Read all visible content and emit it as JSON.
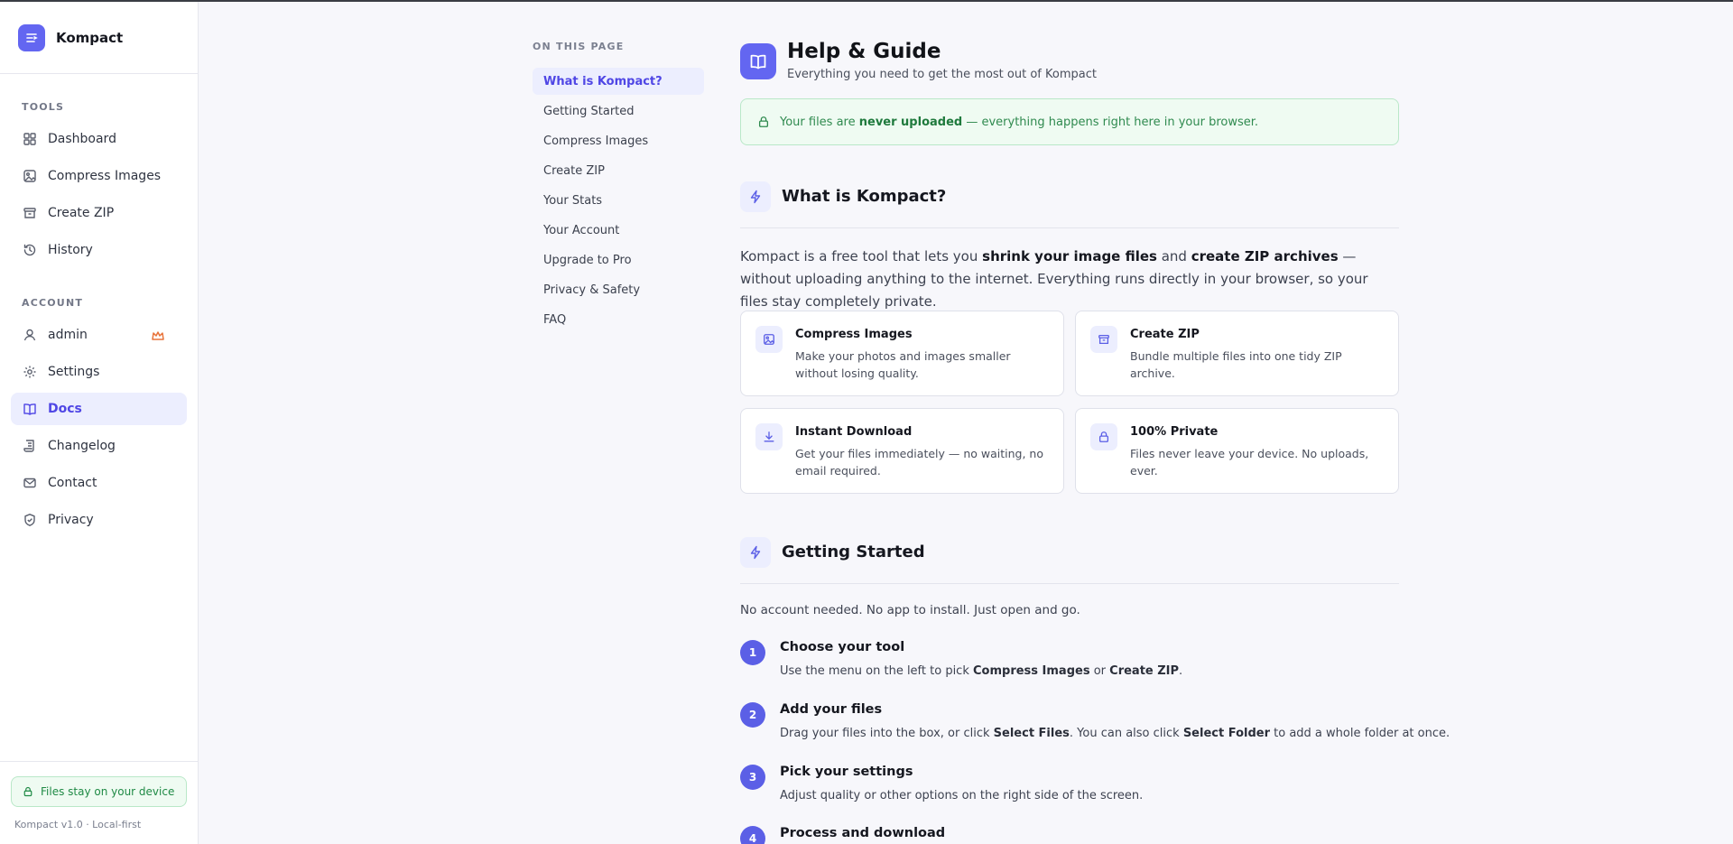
{
  "app": {
    "name": "Kompact",
    "version": "Kompact v1.0 · Local-first"
  },
  "sidebar": {
    "tools_heading": "TOOLS",
    "account_heading": "ACCOUNT",
    "tools": [
      {
        "label": "Dashboard",
        "icon": "grid-icon"
      },
      {
        "label": "Compress Images",
        "icon": "image-icon"
      },
      {
        "label": "Create ZIP",
        "icon": "archive-icon"
      },
      {
        "label": "History",
        "icon": "history-icon"
      }
    ],
    "account": [
      {
        "label": "admin",
        "icon": "user-icon",
        "badge": "crown-icon"
      },
      {
        "label": "Settings",
        "icon": "gear-icon"
      },
      {
        "label": "Docs",
        "icon": "book-icon",
        "active": true
      },
      {
        "label": "Changelog",
        "icon": "scroll-icon"
      },
      {
        "label": "Contact",
        "icon": "mail-icon"
      },
      {
        "label": "Privacy",
        "icon": "shield-icon"
      }
    ],
    "device_badge": "Files stay on your device"
  },
  "toc": {
    "title": "ON THIS PAGE",
    "items": [
      "What is Kompact?",
      "Getting Started",
      "Compress Images",
      "Create ZIP",
      "Your Stats",
      "Your Account",
      "Upgrade to Pro",
      "Privacy & Safety",
      "FAQ"
    ],
    "active_index": 0
  },
  "hero": {
    "title": "Help & Guide",
    "subtitle": "Everything you need to get the most out of Kompact"
  },
  "banner": {
    "prefix": "Your files are ",
    "bold": "never uploaded",
    "suffix": " — everything happens right here in your browser."
  },
  "what_is": {
    "title": "What is Kompact?",
    "intro_1": "Kompact is a free tool that lets you ",
    "intro_b1": "shrink your image files",
    "intro_2": " and ",
    "intro_b2": "create ZIP archives",
    "intro_3": " — without uploading anything to the internet. Everything runs directly in your browser, so your files stay completely private.",
    "cards": [
      {
        "title": "Compress Images",
        "desc": "Make your photos and images smaller without losing quality.",
        "icon": "image-icon"
      },
      {
        "title": "Create ZIP",
        "desc": "Bundle multiple files into one tidy ZIP archive.",
        "icon": "archive-icon"
      },
      {
        "title": "Instant Download",
        "desc": "Get your files immediately — no waiting, no email required.",
        "icon": "download-icon"
      },
      {
        "title": "100% Private",
        "desc": "Files never leave your device. No uploads, ever.",
        "icon": "lock-icon"
      }
    ]
  },
  "getting_started": {
    "title": "Getting Started",
    "intro": "No account needed. No app to install. Just open and go.",
    "steps": [
      {
        "num": "1",
        "title": "Choose your tool",
        "d1": "Use the menu on the left to pick ",
        "b1": "Compress Images",
        "d2": " or ",
        "b2": "Create ZIP",
        "d3": "."
      },
      {
        "num": "2",
        "title": "Add your files",
        "d1": "Drag your files into the box, or click ",
        "b1": "Select Files",
        "d2": ". You can also click ",
        "b2": "Select Folder",
        "d3": " to add a whole folder at once."
      },
      {
        "num": "3",
        "title": "Pick your settings",
        "d1": "Adjust quality or other options on the right side of the screen."
      },
      {
        "num": "4",
        "title": "Process and download"
      }
    ]
  },
  "colors": {
    "accent": "#6366f1",
    "success": "#1f8a45"
  }
}
